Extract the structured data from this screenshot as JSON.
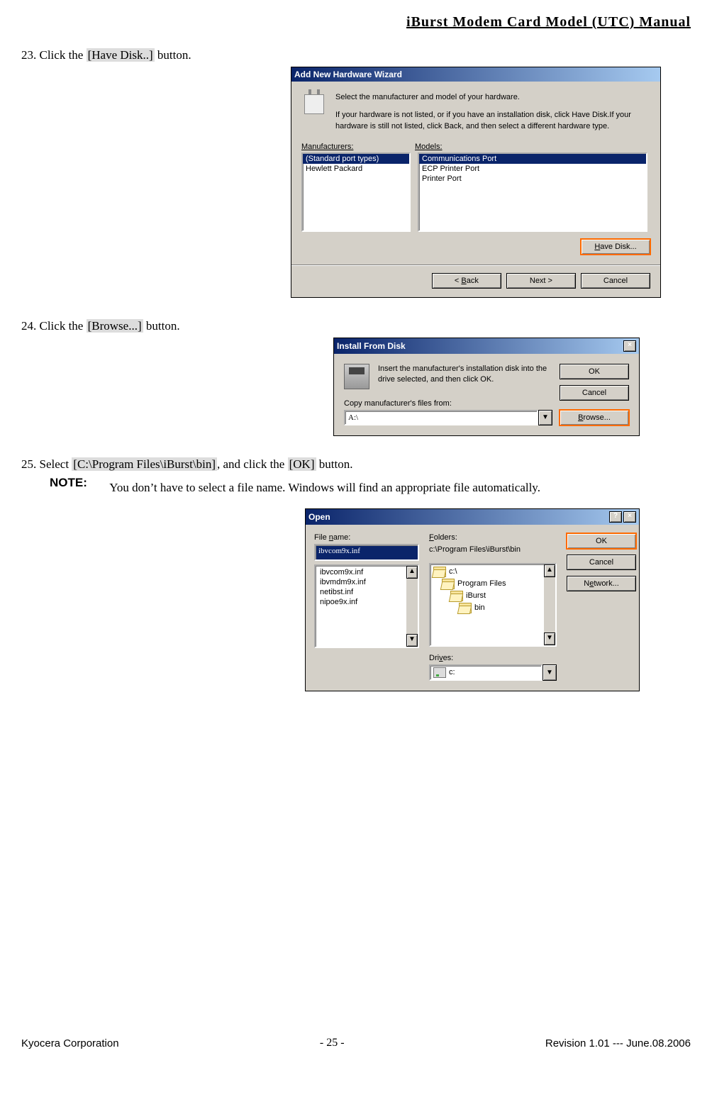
{
  "header": {
    "title": "iBurst Modem Card Model (UTC) Manual"
  },
  "step23": {
    "pre": "23. Click the ",
    "hl": "[Have Disk..]",
    "post": " button."
  },
  "wiz": {
    "title": "Add New Hardware Wizard",
    "msg1": "Select the manufacturer and model of your hardware.",
    "msg2": "If your hardware is not listed, or if you have an installation disk, click Have Disk.If your hardware is still not listed, click Back, and then select a different hardware type.",
    "label_manuf": "Manufacturers:",
    "label_models": "Models:",
    "manuf": [
      "(Standard port types)",
      "Hewlett Packard"
    ],
    "models": [
      "Communications Port",
      "ECP Printer Port",
      "Printer Port"
    ],
    "btn_have_disk": "Have Disk...",
    "btn_back": "< Back",
    "btn_next": "Next >",
    "btn_cancel": "Cancel"
  },
  "step24": {
    "pre": "24. Click the ",
    "hl": "[Browse...]",
    "post": " button."
  },
  "ifd": {
    "title": "Install From Disk",
    "msg": "Insert the manufacturer's installation disk into the drive selected, and then click OK.",
    "label_copy": "Copy manufacturer's files from:",
    "value": "A:\\",
    "btn_ok": "OK",
    "btn_cancel": "Cancel",
    "btn_browse": "Browse..."
  },
  "step25": {
    "pre": "25. Select ",
    "hl1": "[C:\\Program Files\\iBurst\\bin]",
    "mid": ", and click the ",
    "hl2": "[OK]",
    "post": " button."
  },
  "note": {
    "label": "NOTE:",
    "text": "You don’t have to select a file name.  Windows will find an appropriate file automatically."
  },
  "open": {
    "title": "Open",
    "label_filename": "File name:",
    "filename_value": "ibvcom9x.inf",
    "file_list": [
      "ibvcom9x.inf",
      "ibvmdm9x.inf",
      "netibst.inf",
      "nipoe9x.inf"
    ],
    "label_folders": "Folders:",
    "folders_path": "c:\\Program Files\\iBurst\\bin",
    "folder_tree": [
      "c:\\",
      "Program Files",
      "iBurst",
      "bin"
    ],
    "label_drives": "Drives:",
    "drive_value": "c:",
    "btn_ok": "OK",
    "btn_cancel": "Cancel",
    "btn_network": "Network..."
  },
  "footer": {
    "left": "Kyocera Corporation",
    "center": "- 25 -",
    "right": "Revision 1.01 --- June.08.2006"
  }
}
